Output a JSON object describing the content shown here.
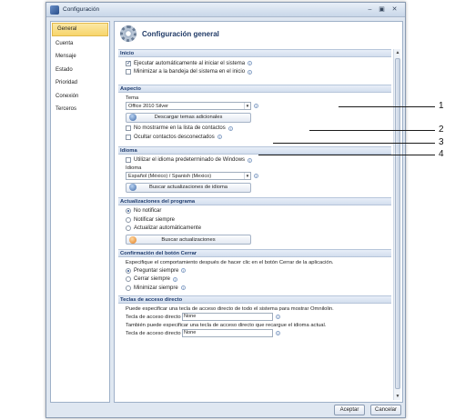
{
  "window": {
    "title": "Configuración"
  },
  "sidebar": {
    "items": [
      {
        "label": "General",
        "active": true
      },
      {
        "label": "Cuenta"
      },
      {
        "label": "Mensaje"
      },
      {
        "label": "Estado"
      },
      {
        "label": "Prioridad"
      },
      {
        "label": "Conexión"
      },
      {
        "label": "Terceros"
      }
    ]
  },
  "main": {
    "title": "Configuración general"
  },
  "inicio": {
    "header": "Inicio",
    "options": [
      {
        "label": "Ejecutar automáticamente al iniciar el sistema",
        "checked": true
      },
      {
        "label": "Minimizar a la bandeja del sistema en el inicio",
        "checked": false
      }
    ]
  },
  "aspecto": {
    "header": "Aspecto",
    "tema_label": "Tema",
    "tema_value": "Office 2010 Silver",
    "download_button": "Descargar temas adicionales",
    "options": [
      {
        "label": "No mostrarme en la lista de contactos",
        "checked": false
      },
      {
        "label": "Ocultar contactos desconectados",
        "checked": false
      }
    ]
  },
  "idioma": {
    "header": "Idioma",
    "default_option": "Utilizar el idioma predeterminado de Windows",
    "label": "Idioma",
    "value": "Español (México) / Spanish (Mexico)",
    "update_button": "Buscar actualizaciones de idioma"
  },
  "actualizaciones": {
    "header": "Actualizaciones del programa",
    "options": [
      {
        "label": "No notificar",
        "checked": true
      },
      {
        "label": "Notificar siempre",
        "checked": false
      },
      {
        "label": "Actualizar automáticamente",
        "checked": false
      }
    ],
    "button": "Buscar actualizaciones"
  },
  "cerrar": {
    "header": "Confirmación del botón Cerrar",
    "description": "Especifique el comportamiento después de hacer clic en el botón Cerrar de la aplicación.",
    "options": [
      {
        "label": "Preguntar siempre",
        "checked": true
      },
      {
        "label": "Cerrar siempre",
        "checked": false
      },
      {
        "label": "Minimizar siempre",
        "checked": false
      }
    ]
  },
  "teclas": {
    "header": "Teclas de acceso directo",
    "desc1": "Puede especificar una tecla de acceso directo de todo el sistema para mostrar Omnilolin.",
    "label1": "Tecla de acceso directo",
    "value1": "None",
    "desc2": "También puede especificar una tecla de acceso directo que recargue el idioma actual.",
    "label2": "Tecla de acceso directo",
    "value2": "None"
  },
  "footer": {
    "accept": "Aceptar",
    "cancel": "Cancelar"
  },
  "callouts": [
    "1",
    "2",
    "3",
    "4"
  ]
}
